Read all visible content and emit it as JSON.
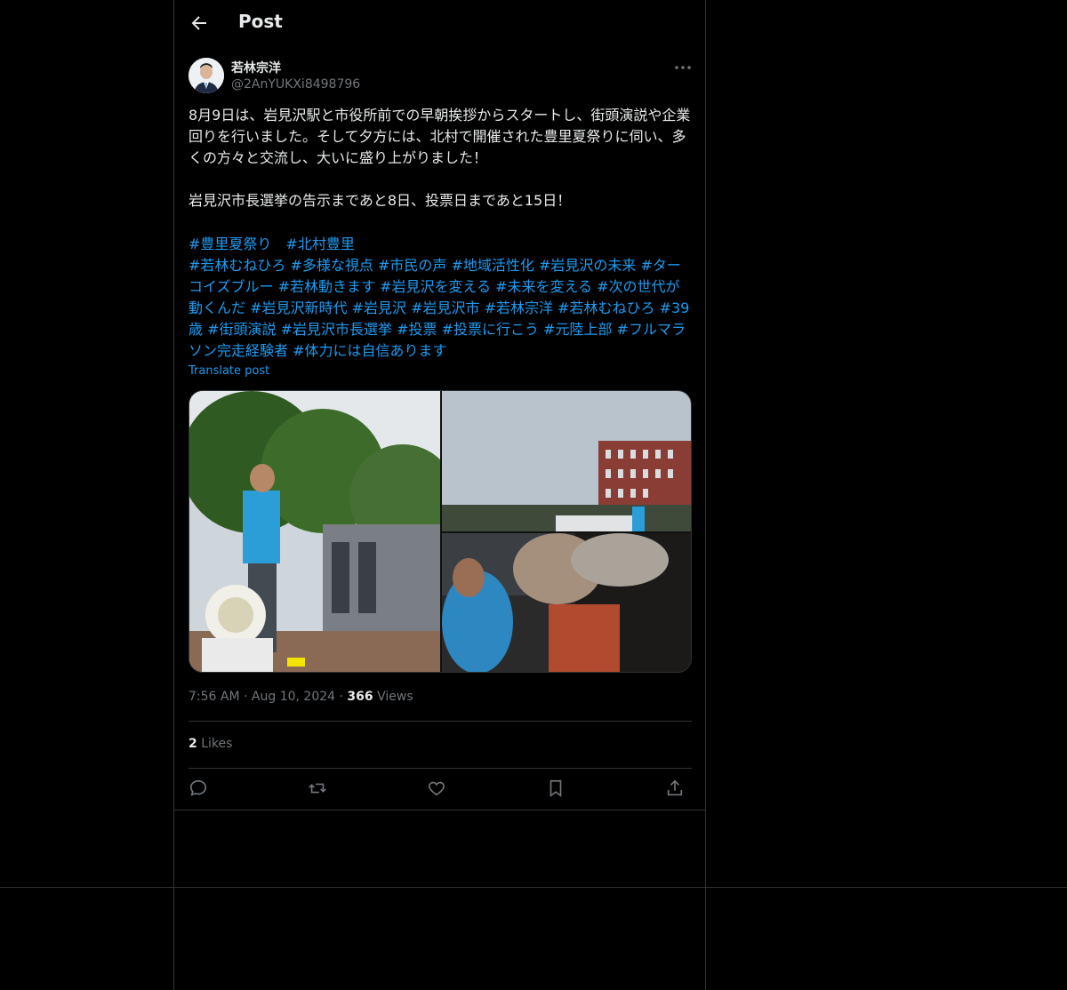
{
  "header": {
    "title": "Post"
  },
  "author": {
    "name": "若林宗洋",
    "handle": "@2AnYUKXi8498796"
  },
  "tweet": {
    "body": "8月9日は、岩見沢駅と市役所前での早朝挨拶からスタートし、街頭演説や企業回りを行いました。そして夕方には、北村で開催された豊里夏祭りに伺い、多くの方々と交流し、大いに盛り上がりました！\n\n岩見沢市長選挙の告示まであと8日、投票日まであと15日！",
    "hashtags_line1": "#豊里夏祭り　#北村豊里",
    "hashtags": "#若林むねひろ #多様な視点 #市民の声 #地域活性化 #岩見沢の未来 #ターコイズブルー #若林動きます #岩見沢を変える #未来を変える #次の世代が動くんだ #岩見沢新時代 #岩見沢 #岩見沢市 #若林宗洋 #若林むねひろ #39歳 #街頭演説 #岩見沢市長選挙 #投票 #投票に行こう #元陸上部 #フルマラソン完走経験者 #体力には自信あります",
    "translate_label": "Translate post"
  },
  "meta": {
    "time": "7:56 AM",
    "date": "Aug 10, 2024",
    "views_count": "366",
    "views_label": "Views"
  },
  "stats": {
    "likes_count": "2",
    "likes_label": "Likes"
  },
  "icons": {
    "back": "arrow-left-icon",
    "more": "more-icon",
    "reply": "reply-icon",
    "repost": "repost-icon",
    "like": "heart-icon",
    "bookmark": "bookmark-icon",
    "share": "share-icon"
  },
  "colors": {
    "background": "#000000",
    "text": "#e7e9ea",
    "muted": "#71767b",
    "link": "#1d9bf0",
    "border": "#2f3336"
  }
}
